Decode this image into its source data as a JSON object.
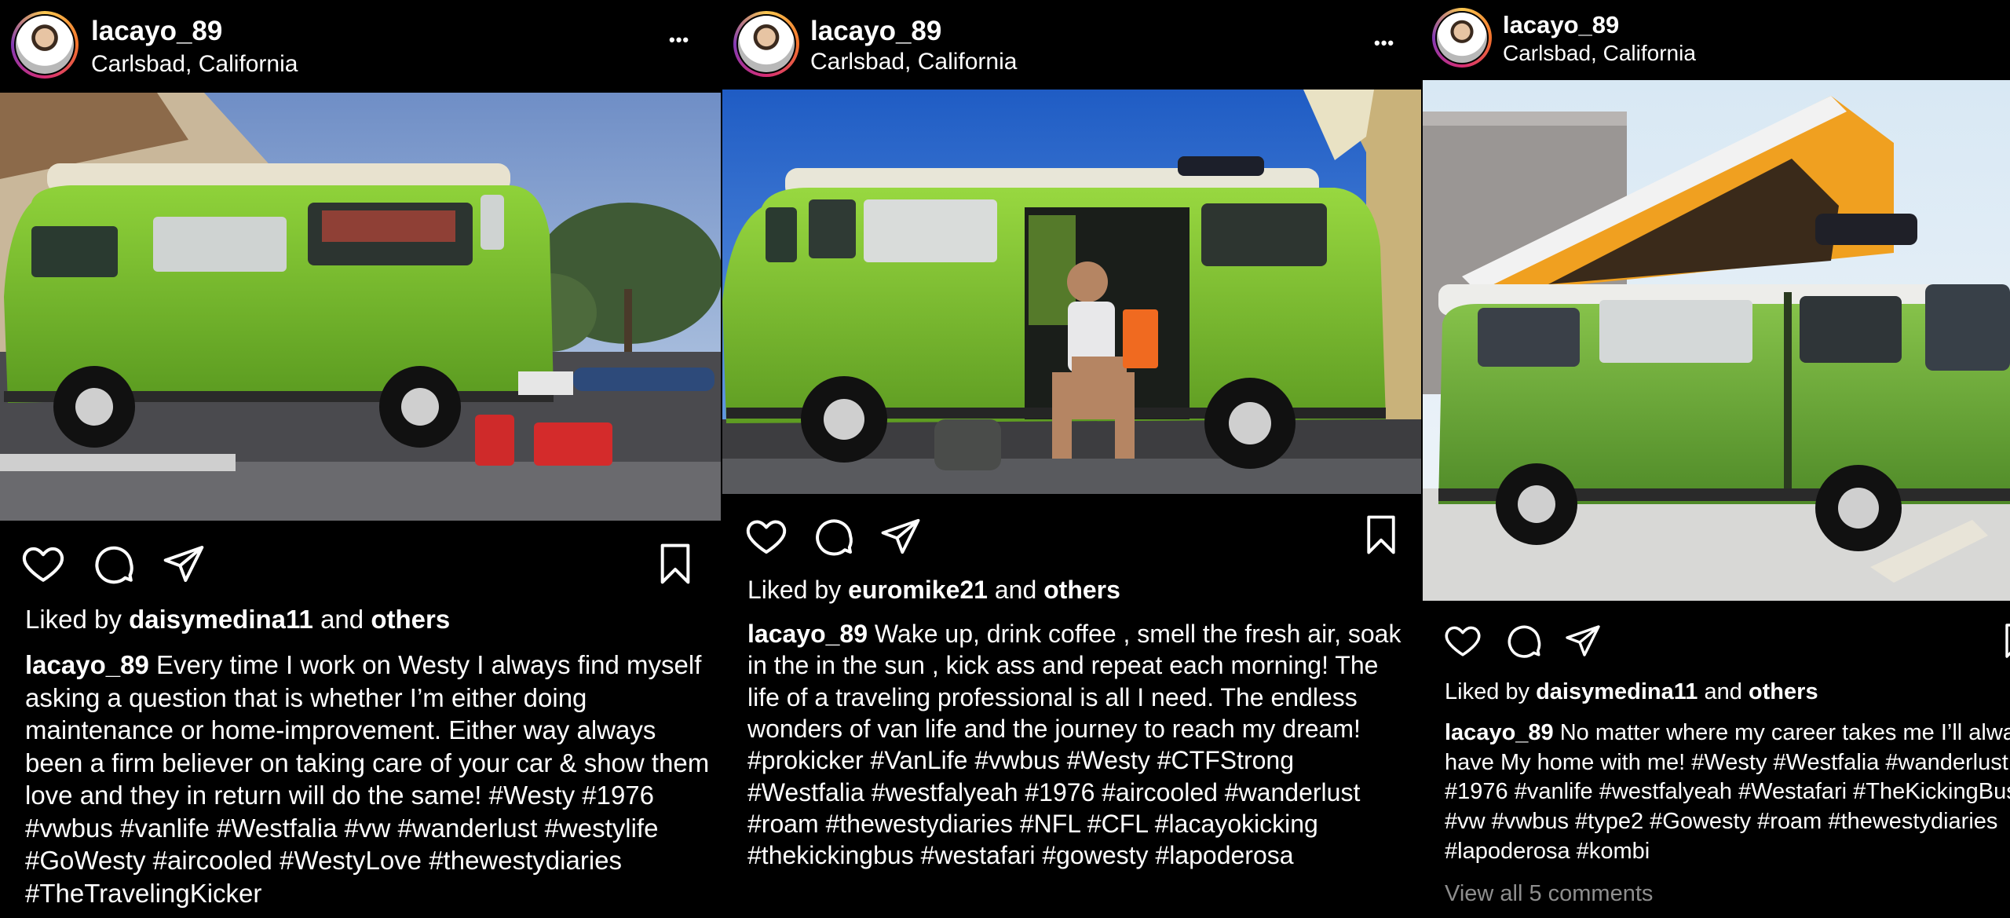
{
  "posts": [
    {
      "username": "lacayo_89",
      "location": "Carlsbad, California",
      "more_label": "•••",
      "liked_prefix": "Liked by",
      "liked_user": "daisymedina11",
      "liked_mid": "and",
      "liked_others": "others",
      "caption_user": "lacayo_89",
      "caption": "Every time I work on Westy I always find myself asking a question that is whether I’m either doing maintenance or home-improvement. Either way always been a firm believer on taking care of your car & show them love and they in  return will do the same! #Westy #1976 #vwbus #vanlife #Westfalia #vw #wanderlust #westylife #GoWesty #aircooled #WestyLove #thewestydiaries #TheTravelingKicker"
    },
    {
      "username": "lacayo_89",
      "location": "Carlsbad, California",
      "more_label": "•••",
      "liked_prefix": "Liked by",
      "liked_user": "euromike21",
      "liked_mid": "and",
      "liked_others": "others",
      "caption_user": "lacayo_89",
      "caption": "Wake up, drink coffee , smell the fresh air, soak in the in the sun , kick ass and repeat each morning! The life of a traveling professional is all I need. The endless wonders of van life and the journey to reach my dream! #prokicker #VanLife #vwbus #Westy #CTFStrong #Westfalia #westfalyeah #1976 #aircooled #wanderlust #roam #thewestydiaries #NFL #CFL #lacayokicking #thekickingbus #westafari #gowesty #lapoderosa"
    },
    {
      "username": "lacayo_89",
      "location": "Carlsbad, California",
      "liked_prefix": "Liked by",
      "liked_user": "daisymedina11",
      "liked_mid": "and",
      "liked_others": "others",
      "caption_user": "lacayo_89",
      "caption": "No matter where my career takes me I’ll always have My home with me! #Westy #Westfalia #wanderlust #1976 #vanlife #westfalyeah #Westafari #TheKickingBus #vw #vwbus #type2 #Gowesty #roam #thewestydiaries #lapoderosa #kombi",
      "comments_link": "View all 5 comments"
    }
  ],
  "colors": {
    "background": "#000000",
    "text": "#ffffff",
    "muted": "#8e8e8e",
    "van_green": "#7cbf2e",
    "poptop_orange": "#f0a020"
  },
  "icons": [
    "heart-icon",
    "comment-icon",
    "share-icon",
    "bookmark-icon",
    "more-icon",
    "avatar"
  ]
}
